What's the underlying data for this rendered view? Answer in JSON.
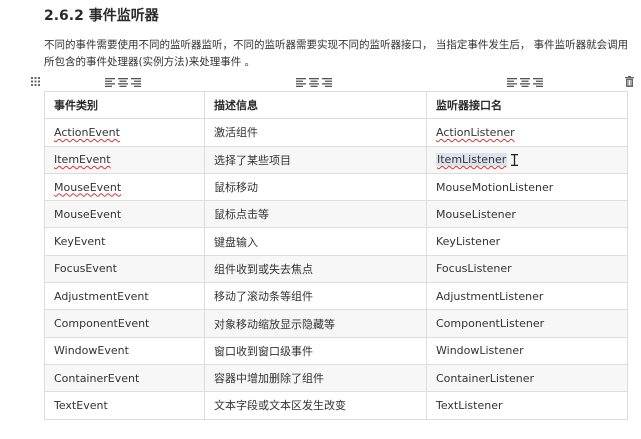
{
  "section": {
    "heading": "2.6.2 事件监听器",
    "paragraph": "不同的事件需要使用不同的监听器监听，不同的监听器需要实现不同的监听器接口， 当指定事件发生后， 事件监听器就会调用所包含的事件处理器(实例方法)来处理事件 。"
  },
  "table_toolbar": {
    "grip_icon": "grip-icon",
    "align_icons": [
      "align-left-icon",
      "align-center-icon",
      "align-right-icon"
    ],
    "delete_icon": "trash-icon"
  },
  "table": {
    "headers": [
      "事件类别",
      "描述信息",
      "监听器接口名"
    ],
    "rows": [
      [
        "ActionEvent",
        "激活组件",
        "ActionListener"
      ],
      [
        "ItemEvent",
        "选择了某些项目",
        "ItemListener"
      ],
      [
        "MouseEvent",
        "鼠标移动",
        "MouseMotionListener"
      ],
      [
        "MouseEvent",
        "鼠标点击等",
        "MouseListener"
      ],
      [
        "KeyEvent",
        "键盘输入",
        "KeyListener"
      ],
      [
        "FocusEvent",
        "组件收到或失去焦点",
        "FocusListener"
      ],
      [
        "AdjustmentEvent",
        "移动了滚动条等组件",
        "AdjustmentListener"
      ],
      [
        "ComponentEvent",
        "对象移动缩放显示隐藏等",
        "ComponentListener"
      ],
      [
        "WindowEvent",
        "窗口收到窗口级事件",
        "WindowListener"
      ],
      [
        "ContainerEvent",
        "容器中增加删除了组件",
        "ContainerListener"
      ],
      [
        "TextEvent",
        "文本字段或文本区发生改变",
        "TextListener"
      ]
    ]
  },
  "colors": {
    "spellcheck_underline": "#e03131",
    "selection_highlight": "#dbe3ee",
    "table_border": "#dddddd",
    "row_stripe": "#f7f7f7"
  }
}
